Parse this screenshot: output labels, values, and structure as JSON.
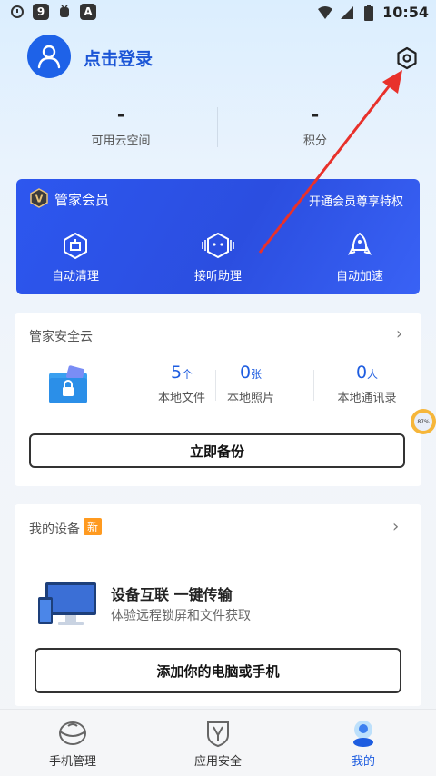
{
  "status": {
    "time": "10:54",
    "mid_icon": "9",
    "app_icon": "A"
  },
  "profile": {
    "login_label": "点击登录"
  },
  "stats": [
    {
      "value": "-",
      "label": "可用云空间"
    },
    {
      "value": "-",
      "label": "积分"
    }
  ],
  "vip": {
    "badge": "V",
    "title": "管家会员",
    "promo": "开通会员尊享特权",
    "features": [
      {
        "label": "自动清理",
        "icon": "cleanup-icon"
      },
      {
        "label": "接听助理",
        "icon": "robot-icon"
      },
      {
        "label": "自动加速",
        "icon": "rocket-icon"
      }
    ]
  },
  "cloud": {
    "title": "管家安全云",
    "metrics": [
      {
        "num": "5",
        "unit": "个",
        "label": "本地文件"
      },
      {
        "num": "0",
        "unit": "张",
        "label": "本地照片"
      },
      {
        "num": "0",
        "unit": "人",
        "label": "本地通讯录"
      }
    ],
    "backup_button": "立即备份"
  },
  "float_badge": {
    "text": "87%"
  },
  "device": {
    "title": "我的设备",
    "new_tag": "新",
    "headline": "设备互联 一键传输",
    "subline": "体验远程锁屏和文件获取",
    "add_button": "添加你的电脑或手机"
  },
  "nav": [
    {
      "label": "手机管理",
      "active": false
    },
    {
      "label": "应用安全",
      "active": false
    },
    {
      "label": "我的",
      "active": true
    }
  ],
  "colors": {
    "accent": "#1e5de0",
    "vip_bg": "#2d57ef",
    "new_tag": "#ff9a1f",
    "annotation_arrow": "#e8312b"
  }
}
